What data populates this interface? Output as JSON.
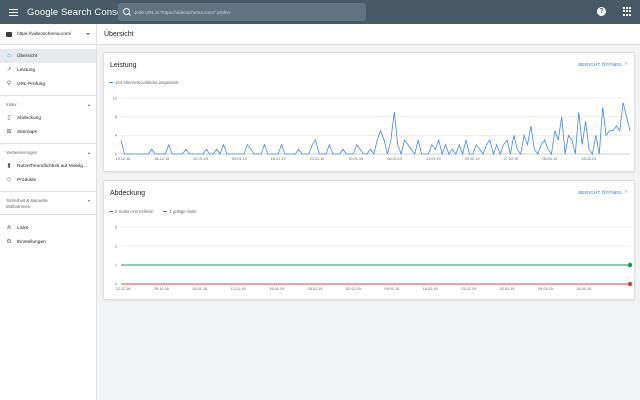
{
  "topbar": {
    "title": "Google Search Console",
    "search_placeholder": "Jede URL in \"https://videoschema.com/\" prüfen",
    "help_label": "?"
  },
  "sidebar": {
    "property": "https://videoschema.com/",
    "items_top": [
      {
        "label": "Übersicht",
        "icon": "home-icon",
        "active": true
      },
      {
        "label": "Leistung",
        "icon": "trending-icon",
        "active": false
      },
      {
        "label": "URL-Prüfung",
        "icon": "search-icon",
        "active": false
      }
    ],
    "section_index": {
      "header": "Index",
      "items": [
        {
          "label": "Abdeckung",
          "icon": "file-icon"
        },
        {
          "label": "Sitemaps",
          "icon": "sitemap-icon"
        }
      ]
    },
    "section_enh": {
      "header": "Verbesserungen",
      "items": [
        {
          "label": "Nutzerfreundlichkeit auf Mobilg...",
          "icon": "phone-icon"
        },
        {
          "label": "Produkte",
          "icon": "diamond-icon"
        }
      ]
    },
    "section_sec": {
      "header_line1": "Sicherheit & Manuelle",
      "header_line2": "Maßnahmen",
      "items": [
        {
          "label": "Links",
          "icon": "links-icon"
        },
        {
          "label": "Einstellungen",
          "icon": "gear-icon"
        }
      ]
    }
  },
  "page": {
    "title": "Übersicht"
  },
  "performance": {
    "title": "Leistung",
    "report_link": "BERICHT ÖFFNEN",
    "legend": "144 Internetsuchklicks insgesamt",
    "color": "#4285f4"
  },
  "coverage": {
    "title": "Abdeckung",
    "report_link": "BERICHT ÖFFNEN",
    "legend_errors": "0 Seiten mit Fehlern",
    "legend_valid": "1 gültige Seite",
    "color_errors": "#db4437",
    "color_valid": "#0f9d58"
  },
  "chart_data": [
    {
      "type": "line",
      "title": "",
      "ylim": [
        0,
        12
      ],
      "yticks": [
        0,
        4,
        8,
        12
      ],
      "xticks": [
        "19.12.18",
        "26.12.18",
        "02.01.19",
        "09.01.19",
        "16.01.19",
        "23.01.19",
        "30.01.19",
        "06.02.19",
        "13.02.19",
        "20.02.19",
        "27.02.19",
        "06.03.19",
        "13.03.19"
      ],
      "series": [
        {
          "name": "144 Internetsuchklicks insgesamt",
          "values": [
            3,
            0,
            0,
            0,
            0,
            0,
            0,
            0,
            0,
            1,
            0,
            0,
            0,
            0,
            2,
            0,
            0,
            0,
            0,
            1,
            0,
            0,
            0,
            0,
            0,
            1,
            0,
            0,
            1,
            0,
            2,
            0,
            0,
            0,
            0,
            0,
            0,
            2,
            1,
            0,
            0,
            0,
            2,
            0,
            0,
            0,
            0,
            2,
            0,
            0,
            0,
            0,
            1,
            0,
            0,
            0,
            2,
            3,
            0,
            0,
            0,
            2,
            0,
            0,
            0,
            1,
            0,
            0,
            0,
            2,
            1,
            0,
            0,
            1,
            0,
            3,
            5,
            3,
            0,
            3,
            9,
            2,
            0,
            3,
            2,
            1,
            0,
            3,
            0,
            0,
            0,
            2,
            1,
            3,
            0,
            2,
            0,
            1,
            0,
            2,
            0,
            3,
            0,
            0,
            2,
            1,
            0,
            2,
            3,
            0,
            2,
            0,
            2,
            3,
            0,
            4,
            1,
            0,
            4,
            2,
            6,
            1,
            0,
            2,
            3,
            1,
            0,
            5,
            3,
            8,
            0,
            4,
            3,
            0,
            9,
            2,
            7,
            1,
            0,
            4,
            0,
            10,
            4,
            5,
            5,
            6,
            5,
            11,
            8,
            5
          ]
        }
      ]
    },
    {
      "type": "line",
      "title": "",
      "ylim": [
        0,
        3
      ],
      "yticks": [
        0,
        1,
        2,
        3
      ],
      "xticks": [
        "22.12.18",
        "29.12.18",
        "05.01.19",
        "12.01.19",
        "19.01.19",
        "26.01.19",
        "02.02.19",
        "09.02.19",
        "16.02.19",
        "23.02.19",
        "02.03.19",
        "09.03.19",
        "16.03.19"
      ],
      "series": [
        {
          "name": "0 Seiten mit Fehlern",
          "values": [
            0,
            0
          ]
        },
        {
          "name": "1 gültige Seite",
          "values": [
            1,
            1
          ]
        }
      ]
    }
  ]
}
